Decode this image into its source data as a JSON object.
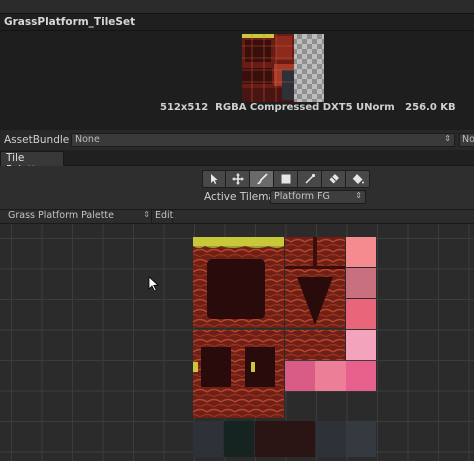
{
  "preview": {
    "title": "GrassPlatform_TileSet",
    "info": "512x512  RGBA Compressed DXT5 UNorm   256.0 KB"
  },
  "asset_bundle": {
    "label": "AssetBundle",
    "value": "None",
    "variant_value": "None"
  },
  "tabs": {
    "tile_palette": "Tile Palette"
  },
  "tools": [
    {
      "name": "select",
      "icon": "arrow-cursor-icon",
      "active": false
    },
    {
      "name": "move",
      "icon": "move-cross-icon",
      "active": false
    },
    {
      "name": "paint",
      "icon": "brush-icon",
      "active": true
    },
    {
      "name": "box-fill",
      "icon": "box-fill-icon",
      "active": false
    },
    {
      "name": "pick",
      "icon": "picker-icon",
      "active": false
    },
    {
      "name": "erase",
      "icon": "eraser-icon",
      "active": false
    },
    {
      "name": "flood-fill",
      "icon": "paint-bucket-icon",
      "active": false
    }
  ],
  "active_tilemap": {
    "label": "Active Tilemap",
    "value": "Platform FG"
  },
  "palette": {
    "selected": "Grass Platform Palette",
    "edit_label": "Edit"
  },
  "colors": {
    "rock_dark": "#5a1a12",
    "rock_mid": "#8c2a1c",
    "rock_light": "#b8452c",
    "grass": "#c8c83a",
    "pink_1": "#f58a8f",
    "pink_2": "#c9707e",
    "pink_3": "#e8657a",
    "pink_4": "#f3a3bb",
    "pink_5": "#d85c86",
    "pink_6": "#ec7e98",
    "pink_7": "#e8608c",
    "stone": "#2e3238",
    "teal": "#152420",
    "maroon": "#2a1414"
  }
}
